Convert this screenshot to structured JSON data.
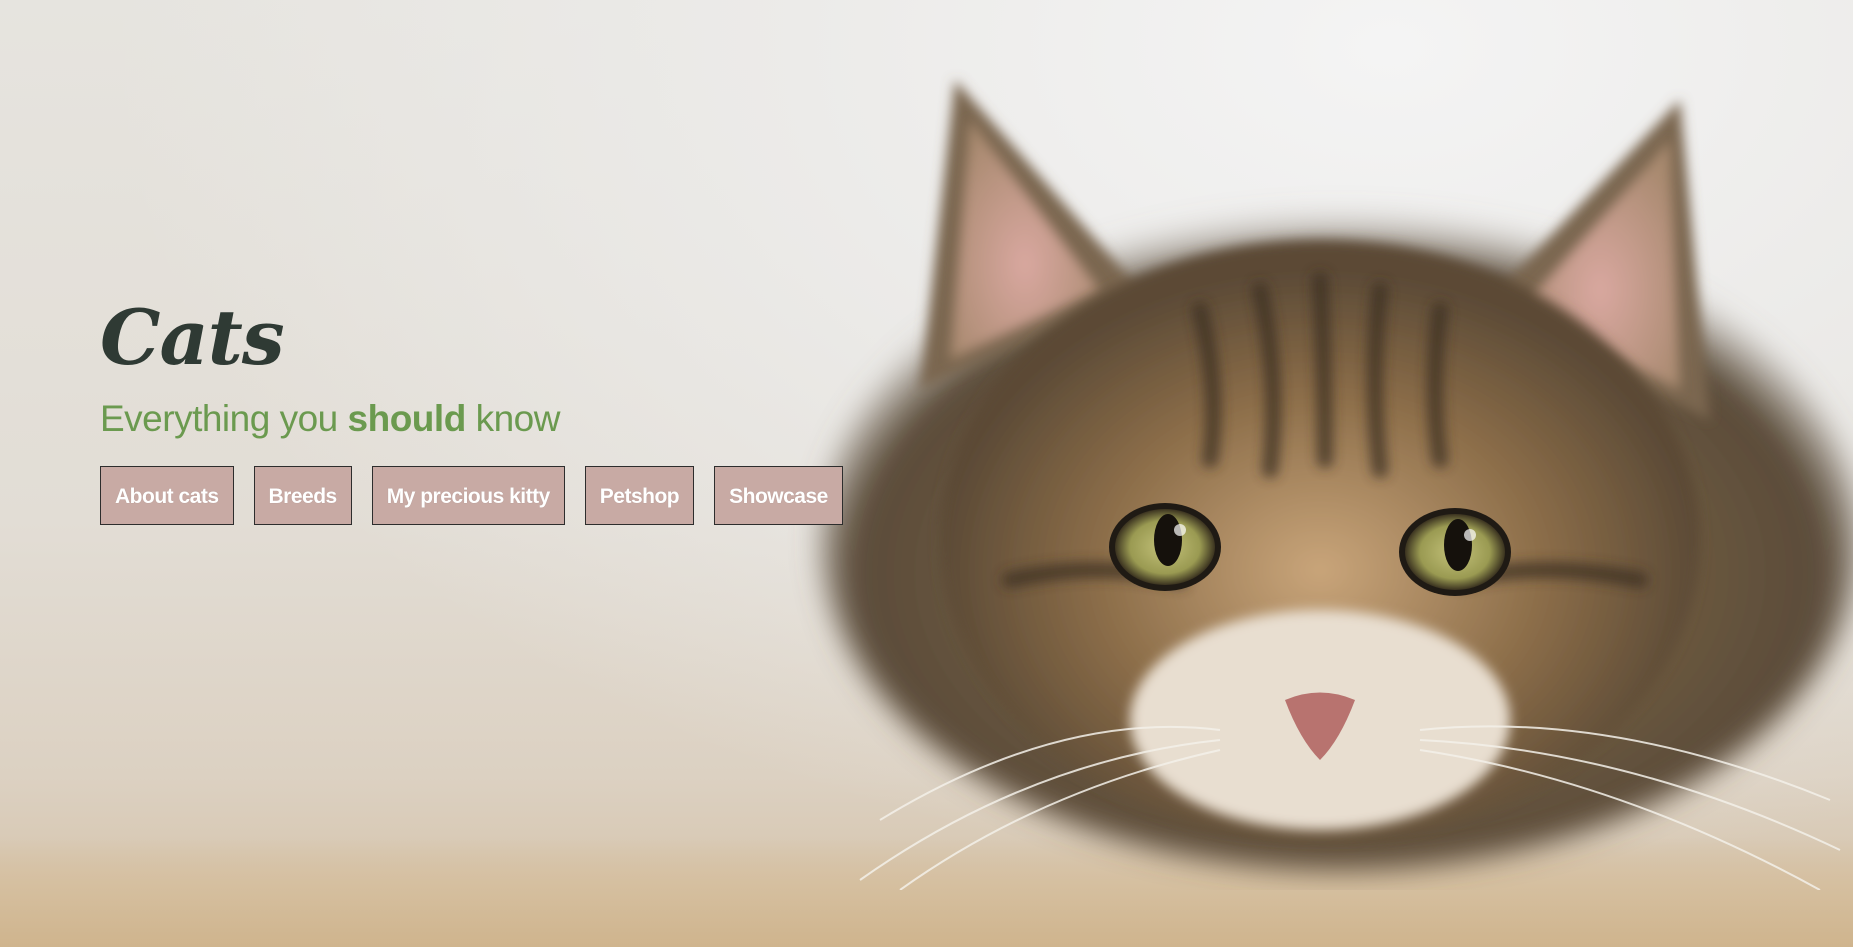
{
  "hero": {
    "title": "Cats",
    "tagline_before": "Everything you ",
    "tagline_emphasis": "should",
    "tagline_after": " know",
    "image": "tabby-cat-photo"
  },
  "nav": {
    "items": [
      {
        "label": "About cats"
      },
      {
        "label": "Breeds"
      },
      {
        "label": "My precious kitty"
      },
      {
        "label": "Petshop"
      },
      {
        "label": "Showcase"
      }
    ]
  },
  "colors": {
    "title": "#2f3a34",
    "tagline": "#6b9a4f",
    "button_bg": "#c8aaa4",
    "button_border": "#2d2d2d",
    "button_text": "#ffffff"
  }
}
